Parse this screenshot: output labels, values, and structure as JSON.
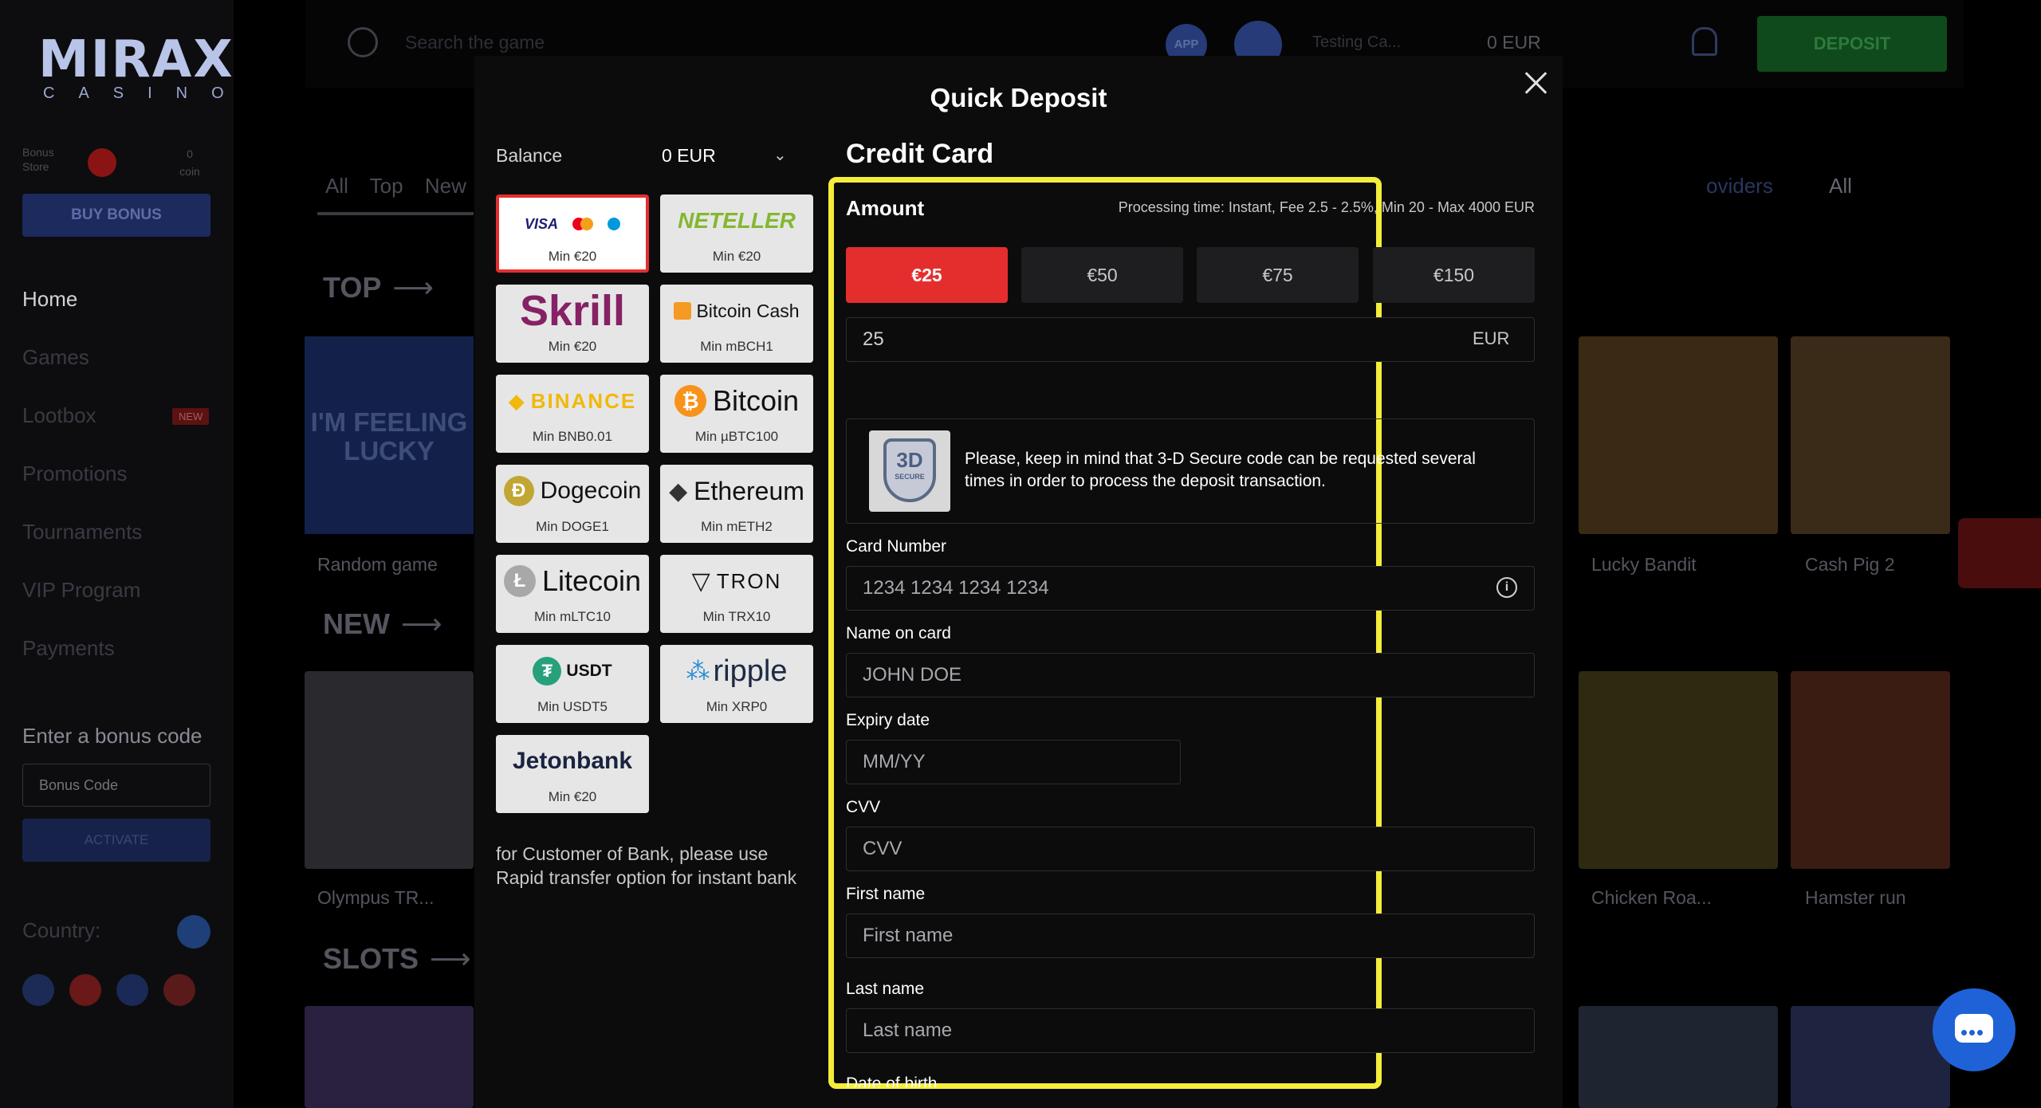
{
  "site": {
    "logo_main": "MIRAX",
    "logo_sub": "CASINO",
    "bonus_store_label": "Bonus Store",
    "coin_count": "0",
    "coin_label": "coin",
    "buy_bonus_label": "BUY BONUS",
    "nav": [
      {
        "label": "Home",
        "active": true
      },
      {
        "label": "Games"
      },
      {
        "label": "Lootbox",
        "badge": "NEW"
      },
      {
        "label": "Promotions"
      },
      {
        "label": "Tournaments"
      },
      {
        "label": "VIP Program"
      },
      {
        "label": "Payments"
      }
    ],
    "bonus_code_title": "Enter a bonus code",
    "bonus_code_placeholder": "Bonus Code",
    "activate_label": "ACTIVATE",
    "country_label": "Country:"
  },
  "header": {
    "search_placeholder": "Search the game",
    "app_label": "APP",
    "user_name": "Testing Ca...",
    "balance": "0 EUR",
    "deposit_label": "DEPOSIT"
  },
  "main": {
    "tabs": [
      "All",
      "Top",
      "New"
    ],
    "sections": [
      "TOP",
      "NEW",
      "SLOTS"
    ],
    "feeling_lucky": "I'M FEELING LUCKY",
    "random_game": "Random game",
    "olympus": "Olympus TR...",
    "right_tab_fragment": "oviders",
    "right_all": "All",
    "games_right": [
      "Lucky Bandit",
      "Cash Pig 2",
      "Chicken Roa...",
      "Hamster run"
    ]
  },
  "modal": {
    "title": "Quick Deposit",
    "balance_label": "Balance",
    "balance_value": "0 EUR",
    "methods": [
      {
        "name": "VISA",
        "min": "Min €20",
        "selected": true
      },
      {
        "name": "NETELLER",
        "min": "Min €20"
      },
      {
        "name": "Skrill",
        "min": "Min €20"
      },
      {
        "name": "Bitcoin Cash",
        "min": "Min mBCH1"
      },
      {
        "name": "BINANCE",
        "min": "Min BNB0.01"
      },
      {
        "name": "Bitcoin",
        "min": "Min µBTC100"
      },
      {
        "name": "Dogecoin",
        "min": "Min DOGE1"
      },
      {
        "name": "Ethereum",
        "min": "Min mETH2"
      },
      {
        "name": "Litecoin",
        "min": "Min mLTC10"
      },
      {
        "name": "TRON",
        "min": "Min TRX10"
      },
      {
        "name": "USDT",
        "min": "Min USDT5"
      },
      {
        "name": "ripple",
        "min": "Min XRP0"
      },
      {
        "name": "Jetonbank",
        "min": "Min €20"
      }
    ],
    "note": "for Customer of Bank, please use Rapid transfer option for instant bank",
    "form": {
      "title": "Credit Card",
      "amount_label": "Amount",
      "processing": "Processing time: Instant, Fee 2.5 - 2.5%, Min 20 - Max 4000 EUR",
      "amounts": [
        "€25",
        "€50",
        "€75",
        "€150"
      ],
      "amount_value": "25",
      "currency": "EUR",
      "secure_badge": "3D",
      "secure_badge_sub": "SECURE",
      "secure_text": "Please, keep in mind that 3-D Secure code can be requested several times in order to process the deposit transaction.",
      "card_number_label": "Card Number",
      "card_number_placeholder": "1234 1234 1234 1234",
      "name_label": "Name on card",
      "name_placeholder": "JOHN DOE",
      "expiry_label": "Expiry date",
      "expiry_placeholder": "MM/YY",
      "cvv_label": "CVV",
      "cvv_placeholder": "CVV",
      "first_name_label": "First name",
      "first_name_placeholder": "First name",
      "last_name_label": "Last name",
      "last_name_placeholder": "Last name",
      "dob_label": "Date of birth"
    }
  },
  "colors": {
    "accent_red": "#e42e2e",
    "highlight": "#f4ee3a",
    "deposit_green": "#0f4a1c"
  }
}
